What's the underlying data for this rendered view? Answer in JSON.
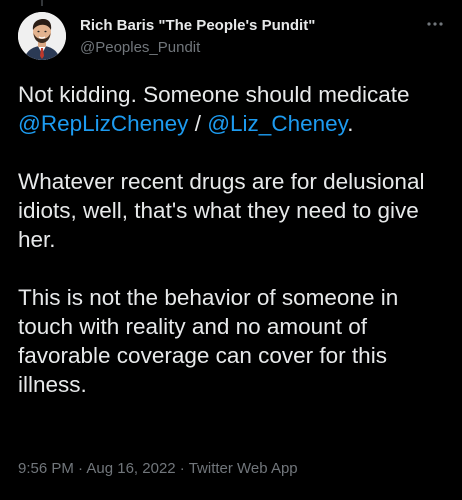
{
  "tweet": {
    "author": {
      "display_name": "Rich Baris \"The People's Pundit\"",
      "handle": "@Peoples_Pundit",
      "avatar_icon": "avatar-illustration-icon"
    },
    "more_icon": "more-options-icon",
    "paragraphs": {
      "p1": {
        "text1": "Not kidding. Someone should medicate ",
        "mention1": "@RepLizCheney",
        "text2": " / ",
        "mention2": "@Liz_Cheney",
        "text3": "."
      },
      "p2": {
        "text": "Whatever recent drugs are for delusional idiots, well, that's what they need to give her."
      },
      "p3": {
        "text": "This is not the behavior of someone in touch with reality and no amount of favorable coverage can cover for this illness."
      }
    },
    "meta": {
      "time": "9:56 PM",
      "separator": " · ",
      "date": "Aug 16, 2022",
      "source": "Twitter Web App"
    }
  },
  "colors": {
    "background": "#000000",
    "text_primary": "#e7e9ea",
    "text_secondary": "#71767b",
    "link": "#1d9bf0"
  }
}
